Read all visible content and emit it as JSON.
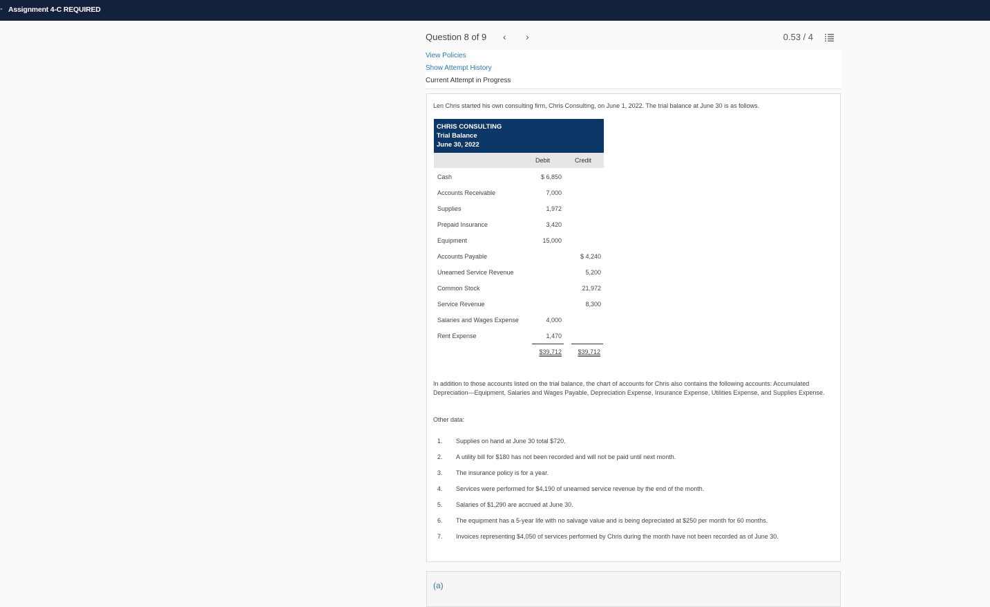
{
  "header": {
    "dash": "-",
    "title": "Assignment 4-C REQUIRED"
  },
  "question_nav": {
    "label": "Question 8 of 9",
    "prev": "‹",
    "next": "›",
    "score": "0.53 / 4"
  },
  "links": {
    "view_policies": "View Policies",
    "show_history": "Show Attempt History",
    "status": "Current Attempt in Progress"
  },
  "problem": {
    "intro": "Len Chris started his own consulting firm, Chris Consulting, on June 1, 2022. The trial balance at June 30 is as follows.",
    "table": {
      "company": "CHRIS CONSULTING",
      "statement": "Trial Balance",
      "date": "June 30, 2022",
      "col_debit": "Debit",
      "col_credit": "Credit",
      "rows": [
        {
          "account": "Cash",
          "debit": "$ 6,850",
          "credit": ""
        },
        {
          "account": "Accounts Receivable",
          "debit": "7,000",
          "credit": ""
        },
        {
          "account": "Supplies",
          "debit": "1,972",
          "credit": ""
        },
        {
          "account": "Prepaid Insurance",
          "debit": "3,420",
          "credit": ""
        },
        {
          "account": "Equipment",
          "debit": "15,000",
          "credit": ""
        },
        {
          "account": "Accounts Payable",
          "debit": "",
          "credit": "$ 4,240"
        },
        {
          "account": "Unearned Service Revenue",
          "debit": "",
          "credit": "5,200"
        },
        {
          "account": "Common Stock",
          "debit": "",
          "credit": "21,972"
        },
        {
          "account": "Service Revenue",
          "debit": "",
          "credit": "8,300"
        },
        {
          "account": "Salaries and Wages Expense",
          "debit": "4,000",
          "credit": ""
        },
        {
          "account": "Rent Expense",
          "debit": "1,470",
          "credit": ""
        }
      ],
      "total_debit": "$39,712",
      "total_credit": "$39,712"
    },
    "additional": "In addition to those accounts listed on the trial balance, the chart of accounts for Chris also contains the following accounts: Accumulated Depreciation—Equipment, Salaries and Wages Payable, Depreciation Expense, Insurance Expense, Utilities Expense, and Supplies Expense.",
    "other_label": "Other data:",
    "items": [
      {
        "num": "1.",
        "text": "Supplies on hand at June 30 total $720."
      },
      {
        "num": "2.",
        "text": "A utility bill for $180 has not been recorded and will not be paid until next month."
      },
      {
        "num": "3.",
        "text": "The insurance policy is for a year."
      },
      {
        "num": "4.",
        "text": "Services were performed for $4,190 of unearned service revenue by the end of the month."
      },
      {
        "num": "5.",
        "text": "Salaries of $1,290 are accrued at June 30."
      },
      {
        "num": "6.",
        "text": "The equipment has a 5-year life with no salvage value and is being depreciated at $250 per month for 60 months."
      },
      {
        "num": "7.",
        "text": "Invoices representing $4,050 of services performed by Chris during the month have not been recorded as of June 30."
      }
    ]
  },
  "part_a": {
    "label": "(a)"
  }
}
